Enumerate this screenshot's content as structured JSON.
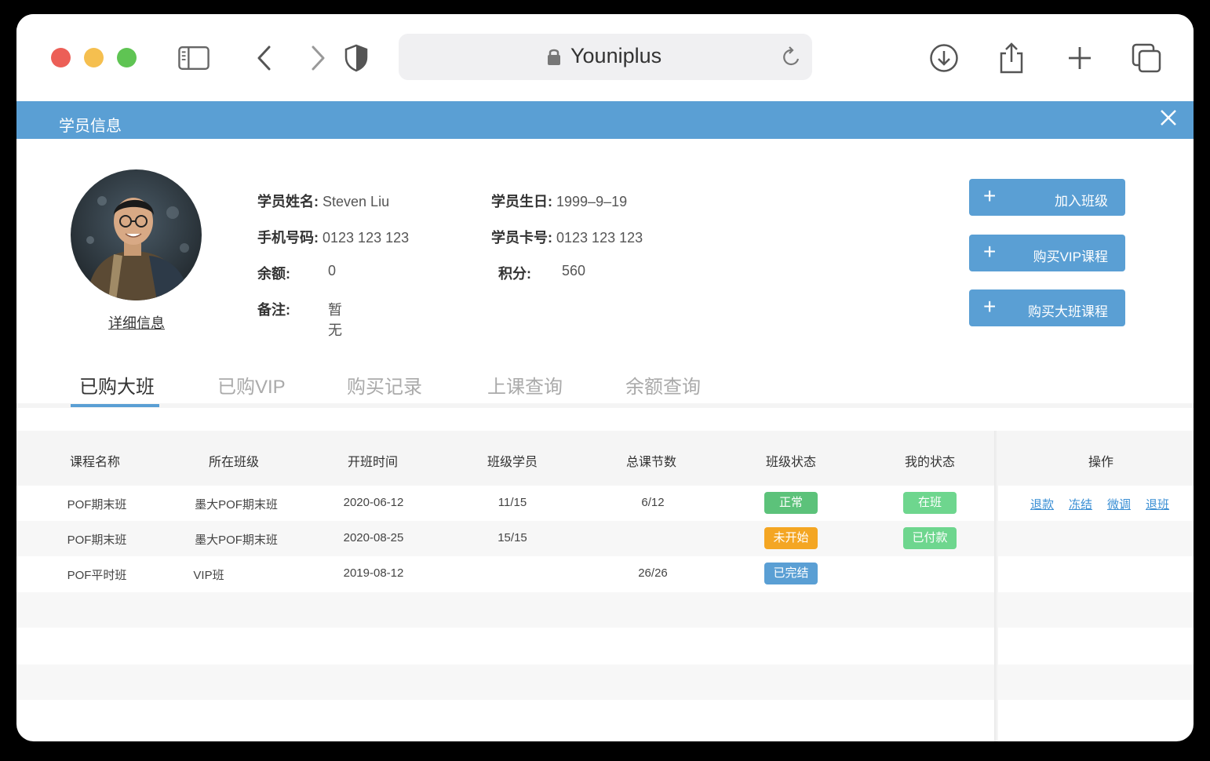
{
  "browser": {
    "address": "Youniplus"
  },
  "modal": {
    "title": "学员信息"
  },
  "profile": {
    "detail_link": "详细信息",
    "fields": {
      "name_label": "学员姓名:",
      "name_value": "Steven Liu",
      "birthday_label": "学员生日:",
      "birthday_value": "1999–9–19",
      "phone_label": "手机号码:",
      "phone_value": "0123 123 123",
      "card_label": "学员卡号:",
      "card_value": "0123 123 123",
      "balance_label": "余额:",
      "balance_value": "0",
      "points_label": "积分:",
      "points_value": "560",
      "note_label": "备注:",
      "note_value": "暂无"
    }
  },
  "actions": [
    {
      "icon": "plus-icon",
      "label": "加入班级"
    },
    {
      "icon": "plus-icon",
      "label": "购买VIP课程"
    },
    {
      "icon": "plus-icon",
      "label": "购买大班课程"
    }
  ],
  "tabs": [
    {
      "label": "已购大班",
      "active": true
    },
    {
      "label": "已购VIP",
      "active": false
    },
    {
      "label": "购买记录",
      "active": false
    },
    {
      "label": "上课查询",
      "active": false
    },
    {
      "label": "余额查询",
      "active": false
    }
  ],
  "table": {
    "headers": [
      "课程名称",
      "所在班级",
      "开班时间",
      "班级学员",
      "总课节数",
      "班级状态",
      "我的状态",
      "操作"
    ],
    "rows": [
      {
        "course": "POF期末班",
        "class": "墨大POF期末班",
        "start": "2020-06-12",
        "students": "11/15",
        "lessons": "6/12",
        "class_status": "正常",
        "my_status": "在班",
        "ops": [
          "退款",
          "冻结",
          "微调",
          "退班"
        ]
      },
      {
        "course": "POF期末班",
        "class": "墨大POF期末班",
        "start": "2020-08-25",
        "students": "15/15",
        "lessons": "",
        "class_status": "未开始",
        "my_status": "已付款",
        "ops": []
      },
      {
        "course": "POF平时班",
        "class": "VIP班",
        "start": "2019-08-12",
        "students": "",
        "lessons": "26/26",
        "class_status": "已完结",
        "my_status": "",
        "ops": []
      }
    ]
  },
  "colors": {
    "accent": "#5a9fd4",
    "status_normal": "#5cc27a",
    "status_pending": "#f4a623",
    "status_done": "#5a9fd4",
    "link": "#3b8fd4"
  }
}
